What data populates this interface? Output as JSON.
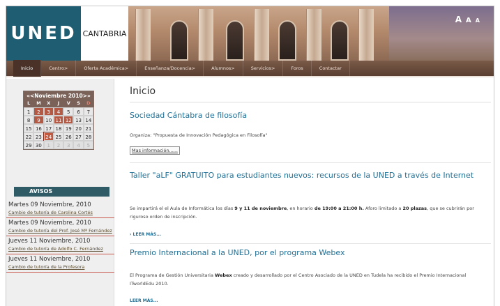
{
  "header": {
    "logo": "UNED",
    "region": "CANTABRIA",
    "font_sizes": [
      "A",
      "A",
      "A"
    ]
  },
  "nav": [
    {
      "label": "Inicio"
    },
    {
      "label": "Centro>"
    },
    {
      "label": "Oferta Académica>"
    },
    {
      "label": "Enseñanza/Docencia>"
    },
    {
      "label": "Alumnos>"
    },
    {
      "label": "Servicios>"
    },
    {
      "label": "Foros"
    },
    {
      "label": "Contactar"
    }
  ],
  "calendar": {
    "prev": "«<",
    "month": "Noviembre 2010",
    "next": ">»",
    "dow": [
      "L",
      "M",
      "X",
      "J",
      "V",
      "S",
      "D"
    ],
    "weeks": [
      [
        "1",
        "2",
        "3",
        "4",
        "5",
        "6",
        "7"
      ],
      [
        "8",
        "9",
        "10",
        "11",
        "12",
        "13",
        "14"
      ],
      [
        "15",
        "16",
        "17",
        "18",
        "19",
        "20",
        "21"
      ],
      [
        "22",
        "23",
        "24",
        "25",
        "26",
        "27",
        "28"
      ],
      [
        "29",
        "30",
        "1",
        "2",
        "3",
        "4",
        "5"
      ]
    ]
  },
  "avisos": {
    "heading": "AVISOS",
    "items": [
      {
        "date": "Martes 09 Noviembre, 2010",
        "link": "Cambio de tutoría de Carolina Cortés"
      },
      {
        "date": "Martes 09 Noviembre, 2010",
        "link": "Cambio de tutoría del Prof. José Mª Fernández"
      },
      {
        "date": "Jueves 11 Noviembre, 2010",
        "link": "Cambio de tutoría de Adolfo C. Fernández"
      },
      {
        "date": "Jueves 11 Noviembre, 2010",
        "link": "Cambio de tutoría de la Profesora"
      }
    ]
  },
  "main": {
    "title": "Inicio",
    "articles": [
      {
        "title": "Sociedad Cántabra de filosofía",
        "body": "Organiza: \"Propuesta de Innovación Pedagógica en Filosofía\"",
        "more": "Mas información......"
      },
      {
        "title": "Taller \"aLF\" GRATUITO para estudiantes nuevos: recursos de la UNED a través de Internet",
        "body_pre": "Se impartirá el el Aula de Informática los días ",
        "body_b1": "9 y 11 de noviembre",
        "body_mid": ", en horario ",
        "body_b2": "de 19:00 a 21:00 h.",
        "body_mid2": " Aforo limitado a ",
        "body_b3": "20 plazas",
        "body_post": ", que se cubrirán por riguroso orden de inscripción.",
        "more": "› LEER MÁS..."
      },
      {
        "title": "Premio Internacional a la UNED, por el programa Webex",
        "body_pre": "El Programa de Gestión Universitaria ",
        "body_b1": "Webex",
        "body_post": " creado y desarrollado por el Centro Asociado de la UNED en Tudela ha recibido el Premio Internacional ITworldEdu 2010.",
        "more": "LEER MÁS..."
      }
    ]
  },
  "colors": {
    "brand": "#1f5e72",
    "nav": "#5a3f32",
    "link": "#1f6f95",
    "event": "#b45a44"
  }
}
